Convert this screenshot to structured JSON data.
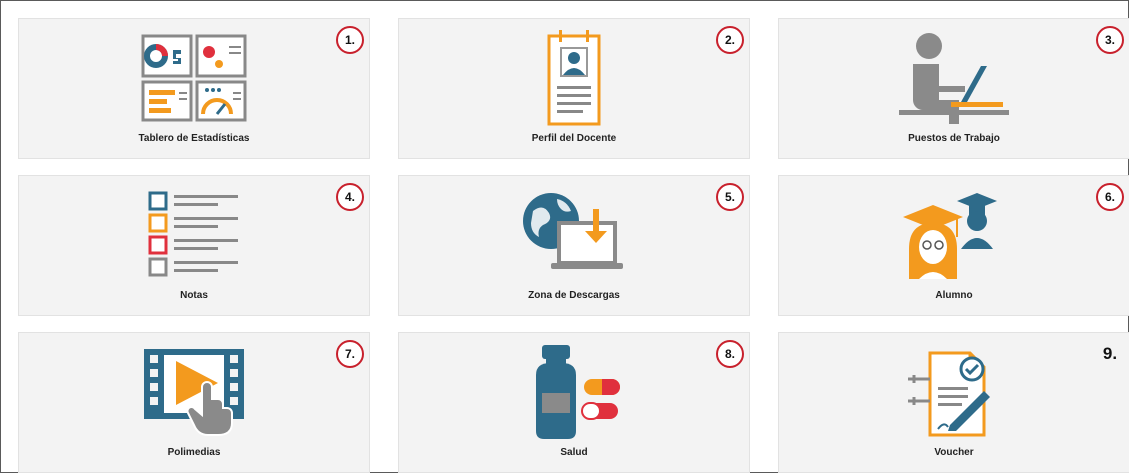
{
  "colors": {
    "tile_bg": "#f3f3f3",
    "badge_ring": "#c8202c",
    "accent_orange": "#f39a1e",
    "accent_blue": "#2e6b8a",
    "accent_red": "#e0303d",
    "icon_gray": "#8a8a8a"
  },
  "tiles": [
    {
      "number": "1.",
      "label": "Tablero de Estadísticas",
      "icon": "dashboard-icon"
    },
    {
      "number": "2.",
      "label": "Perfil del Docente",
      "icon": "teacher-profile-icon"
    },
    {
      "number": "3.",
      "label": "Puestos de Trabajo",
      "icon": "workstation-icon"
    },
    {
      "number": "4.",
      "label": "Notas",
      "icon": "grades-list-icon"
    },
    {
      "number": "5.",
      "label": "Zona de Descargas",
      "icon": "download-zone-icon"
    },
    {
      "number": "6.",
      "label": "Alumno",
      "icon": "students-icon"
    },
    {
      "number": "7.",
      "label": "Polimedias",
      "icon": "video-play-icon"
    },
    {
      "number": "8.",
      "label": "Salud",
      "icon": "health-icon"
    },
    {
      "number": "9.",
      "label": "Voucher",
      "icon": "voucher-icon"
    }
  ]
}
